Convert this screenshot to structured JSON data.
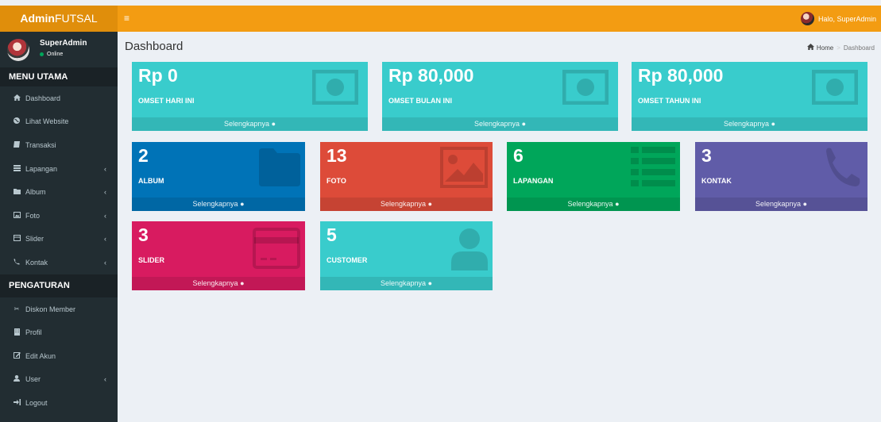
{
  "header": {
    "logo_bold": "Admin",
    "logo_light": "FUTSAL",
    "toggle_icon": "≡",
    "user_greeting": "Halo, SuperAdmin"
  },
  "sidebar": {
    "user_name": "SuperAdmin",
    "user_status": "Online",
    "section_main": "MENU UTAMA",
    "main_items": [
      {
        "label": "Dashboard",
        "icon": "dashboard-icon",
        "has_submenu": false
      },
      {
        "label": "Lihat Website",
        "icon": "globe-icon",
        "has_submenu": false
      },
      {
        "label": "Transaksi",
        "icon": "book-icon",
        "has_submenu": false
      },
      {
        "label": "Lapangan",
        "icon": "list-icon",
        "has_submenu": true
      },
      {
        "label": "Album",
        "icon": "folder-icon",
        "has_submenu": true
      },
      {
        "label": "Foto",
        "icon": "image-icon",
        "has_submenu": true
      },
      {
        "label": "Slider",
        "icon": "slider-icon",
        "has_submenu": true
      },
      {
        "label": "Kontak",
        "icon": "phone-icon",
        "has_submenu": true
      }
    ],
    "section_settings": "PENGATURAN",
    "settings_items": [
      {
        "label": "Diskon Member",
        "icon": "scissors-icon",
        "has_submenu": false
      },
      {
        "label": "Profil",
        "icon": "building-icon",
        "has_submenu": false
      },
      {
        "label": "Edit Akun",
        "icon": "edit-icon",
        "has_submenu": false
      },
      {
        "label": "User",
        "icon": "user-icon",
        "has_submenu": true
      },
      {
        "label": "Logout",
        "icon": "sign-out-icon",
        "has_submenu": false
      }
    ]
  },
  "content": {
    "title": "Dashboard",
    "breadcrumb_home": "Home",
    "breadcrumb_current": "Dashboard",
    "more_label": "Selengkapnya",
    "revenue": [
      {
        "value": "Rp 0",
        "label": "OMSET HARI INI",
        "color": "#39cccc",
        "icon": "money-icon"
      },
      {
        "value": "Rp 80,000",
        "label": "OMSET BULAN INI",
        "color": "#39cccc",
        "icon": "money-icon"
      },
      {
        "value": "Rp 80,000",
        "label": "OMSET TAHUN INI",
        "color": "#39cccc",
        "icon": "money-icon"
      }
    ],
    "stats": [
      {
        "value": "2",
        "label": "ALBUM",
        "color": "#0073b7",
        "icon": "folder-icon"
      },
      {
        "value": "13",
        "label": "FOTO",
        "color": "#dd4b39",
        "icon": "image-icon"
      },
      {
        "value": "6",
        "label": "LAPANGAN",
        "color": "#00a65a",
        "icon": "list-icon"
      },
      {
        "value": "3",
        "label": "KONTAK",
        "color": "#605ca8",
        "icon": "phone-icon"
      },
      {
        "value": "3",
        "label": "SLIDER",
        "color": "#d81b60",
        "icon": "credit-card-icon"
      },
      {
        "value": "5",
        "label": "CUSTOMER",
        "color": "#39cccc",
        "icon": "user-icon"
      }
    ]
  }
}
